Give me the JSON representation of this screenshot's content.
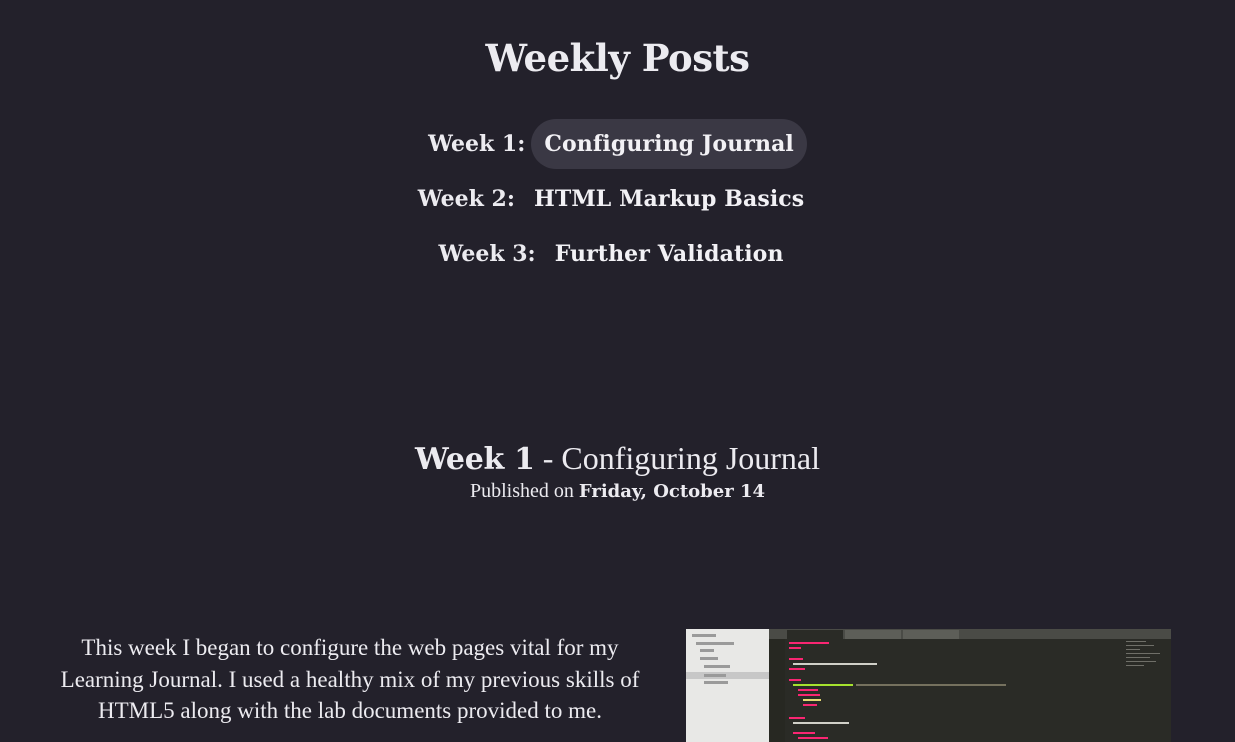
{
  "page": {
    "title": "Weekly Posts"
  },
  "nav": {
    "weeks": [
      {
        "label": "Week 1:",
        "link": "Configuring Journal",
        "active": true
      },
      {
        "label": "Week 2:",
        "link": "HTML Markup Basics",
        "active": false
      },
      {
        "label": "Week 3:",
        "link": "Further Validation",
        "active": false
      }
    ]
  },
  "post": {
    "week": "Week 1",
    "separator": " - ",
    "title": "Configuring Journal",
    "published_prefix": "Published on ",
    "published_date": "Friday, October 14",
    "body": "This week I began to configure the web pages vital for my Learning Journal. I used a healthy mix of my previous skills of HTML5 along with the lab documents provided to me."
  },
  "screenshot": {
    "description_icon": "code-editor-screenshot-image"
  },
  "colors": {
    "background": "#23212b",
    "text": "#ecebf0",
    "active_pill": "#3a3844"
  }
}
